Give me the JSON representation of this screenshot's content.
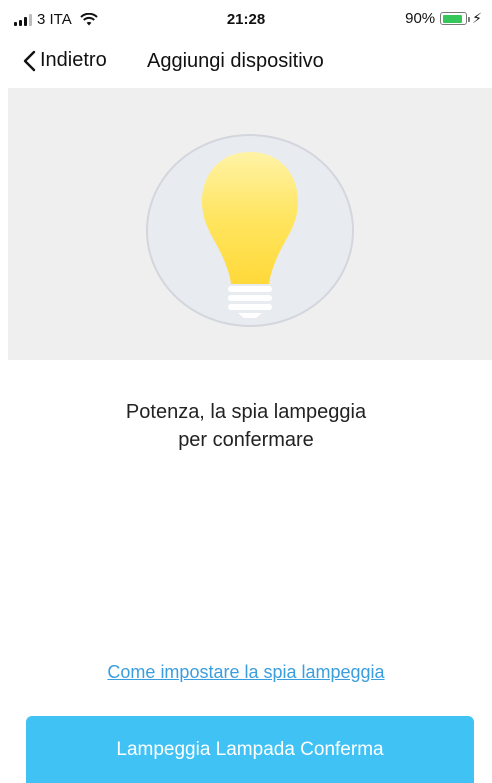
{
  "status_bar": {
    "carrier": "3 ITA",
    "time": "21:28",
    "battery_percent": "90%",
    "battery_level": 0.9,
    "charging_icon": "bolt-icon"
  },
  "nav": {
    "back_label": "Indietro",
    "title": "Aggiungi dispositivo"
  },
  "hero": {
    "icon": "light-bulb-icon"
  },
  "instruction": {
    "line1": "Potenza, la spia lampeggia",
    "line2": "per confermare"
  },
  "help_link": "Come impostare la spia lampeggia",
  "confirm_button": "Lampeggia Lampada Conferma",
  "colors": {
    "accent": "#40c2f5",
    "link": "#3a9ede",
    "bulb": "#ffe04a",
    "battery": "#35c759"
  }
}
